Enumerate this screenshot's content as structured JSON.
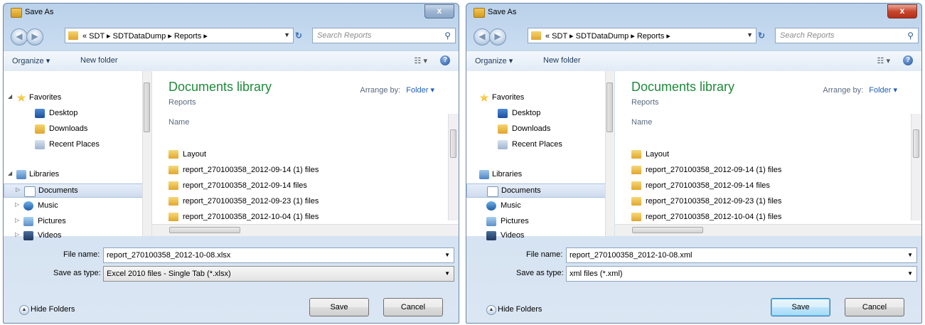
{
  "dialogs": [
    {
      "title": "Save As",
      "close_glyph": "x",
      "address_path": "« SDT ▸ SDTDataDump ▸ Reports ▸",
      "search_placeholder": "Search Reports",
      "toolbar": {
        "organize": "Organize ▾",
        "new_folder": "New folder",
        "views": "☷ ▾",
        "help": "?"
      },
      "nav": {
        "favorites": "Favorites",
        "desktop": "Desktop",
        "downloads": "Downloads",
        "recent": "Recent Places",
        "libraries": "Libraries",
        "documents": "Documents",
        "music": "Music",
        "pictures": "Pictures",
        "videos": "Videos"
      },
      "library_title": "Documents library",
      "library_sub": "Reports",
      "arrange_label": "Arrange by:",
      "arrange_value": "Folder ▾",
      "column_name": "Name",
      "files": [
        "Layout",
        "report_270100358_2012-09-14 (1) files",
        "report_270100358_2012-09-14 files",
        "report_270100358_2012-09-23 (1) files",
        "report_270100358_2012-10-04 (1) files"
      ],
      "file_name_label": "File name:",
      "file_name_value": "report_270100358_2012-10-08.xlsx",
      "save_type_label": "Save as type:",
      "save_type_value": "Excel 2010 files - Single Tab (*.xlsx)",
      "hide_folders": "Hide Folders",
      "save_button": "Save",
      "cancel_button": "Cancel"
    },
    {
      "title": "Save As",
      "close_glyph": "x",
      "address_path": "« SDT ▸ SDTDataDump ▸ Reports ▸",
      "search_placeholder": "Search Reports",
      "toolbar": {
        "organize": "Organize ▾",
        "new_folder": "New folder",
        "views": "☷ ▾",
        "help": "?"
      },
      "nav": {
        "favorites": "Favorites",
        "desktop": "Desktop",
        "downloads": "Downloads",
        "recent": "Recent Places",
        "libraries": "Libraries",
        "documents": "Documents",
        "music": "Music",
        "pictures": "Pictures",
        "videos": "Videos"
      },
      "library_title": "Documents library",
      "library_sub": "Reports",
      "arrange_label": "Arrange by:",
      "arrange_value": "Folder ▾",
      "column_name": "Name",
      "files": [
        "Layout",
        "report_270100358_2012-09-14 (1) files",
        "report_270100358_2012-09-14 files",
        "report_270100358_2012-09-23 (1) files",
        "report_270100358_2012-10-04 (1) files"
      ],
      "file_name_label": "File name:",
      "file_name_value": "report_270100358_2012-10-08.xml",
      "save_type_label": "Save as type:",
      "save_type_value": "xml files (*.xml)",
      "hide_folders": "Hide Folders",
      "save_button": "Save",
      "cancel_button": "Cancel"
    }
  ],
  "colors": {
    "library_title": "#1e8b3a",
    "close_active": "#c7462c",
    "accent": "#1f5fb5"
  }
}
